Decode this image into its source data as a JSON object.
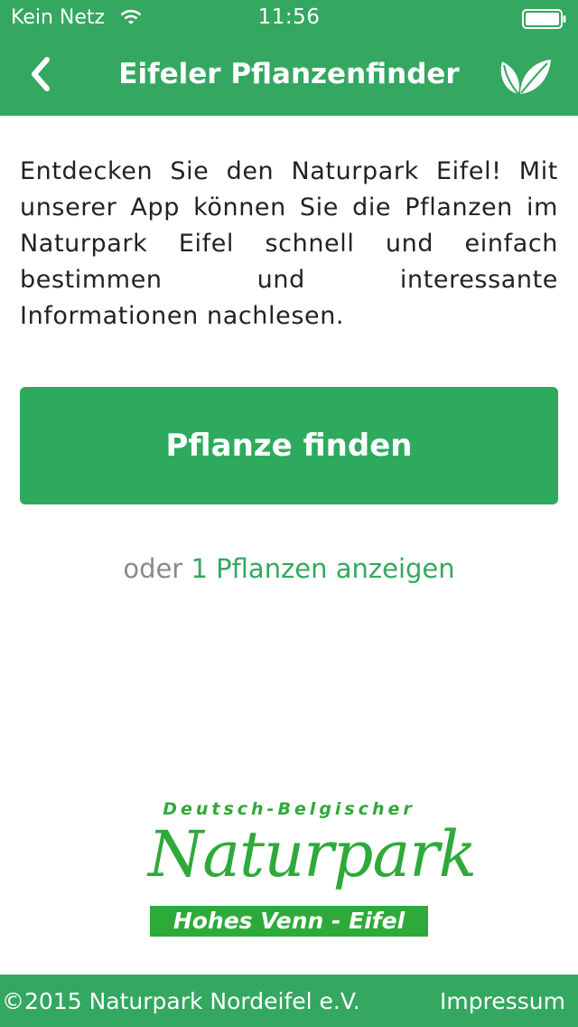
{
  "status_bar": {
    "carrier": "Kein Netz",
    "time": "11:56",
    "icons": [
      "wifi-icon",
      "battery-icon"
    ]
  },
  "nav_bar": {
    "title": "Eifeler Pflanzenfinder",
    "back_icon": "chevron-left-icon",
    "action_icon": "leaf-icon",
    "background": "#34a760"
  },
  "main": {
    "intro": "Entdecken Sie den Naturpark Eifel! Mit unserer App können Sie die Pflanzen im Naturpark Eifel schnell und einfach bestimmen und interessante Informationen nachlesen.",
    "find_button_label": "Pflanze finden",
    "or_text": "oder",
    "show_plants_link": "1 Pflanzen anzeigen",
    "accent": "#2eaa5f"
  },
  "logo": {
    "line1": "Deutsch-Belgischer",
    "line2": "Naturpark",
    "line3": "Hohes Venn - Eifel"
  },
  "footer": {
    "copyright": "©2015 Naturpark Nordeifel e.V.",
    "impressum": "Impressum"
  }
}
